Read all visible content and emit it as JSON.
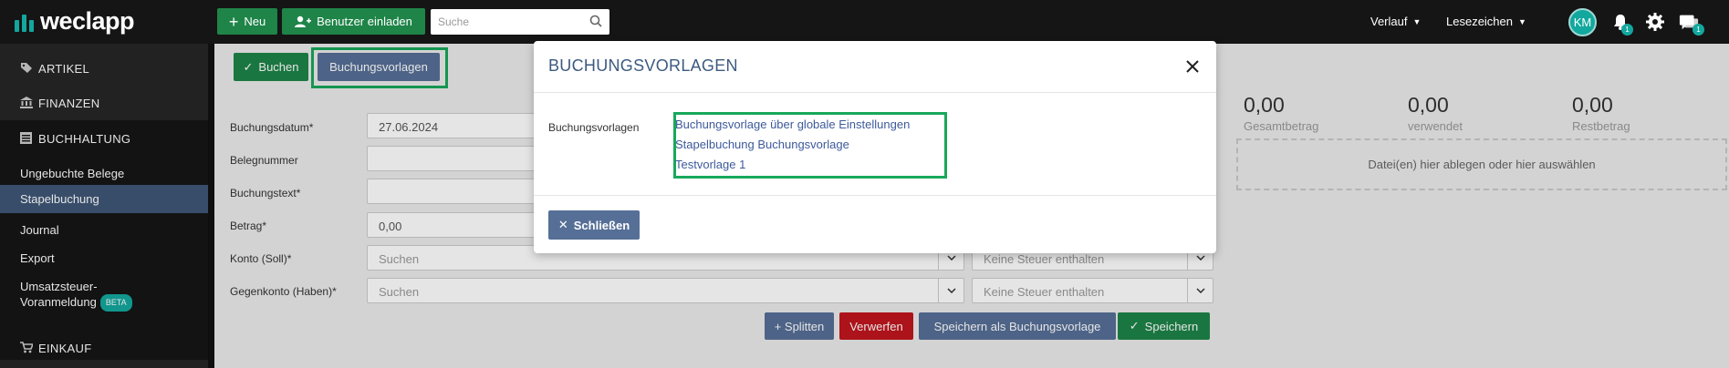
{
  "app": {
    "logo_text": "weclapp",
    "new_button": "Neu",
    "invite_button": "Benutzer einladen",
    "search_placeholder": "Suche",
    "history_label": "Verlauf",
    "bookmarks_label": "Lesezeichen",
    "avatar_initials": "KM",
    "notifications_count": "1",
    "messages_count": "1"
  },
  "sidebar": {
    "sections": [
      {
        "label": "ARTIKEL",
        "icon": "tags-icon"
      },
      {
        "label": "FINANZEN",
        "icon": "bank-icon"
      },
      {
        "label": "BUCHHALTUNG",
        "icon": "ledger-icon"
      }
    ],
    "items": [
      {
        "label": "Ungebuchte Belege"
      },
      {
        "label": "Stapelbuchung",
        "active": true
      },
      {
        "label": "Journal"
      },
      {
        "label": "Export"
      },
      {
        "label": "Umsatzsteuer-",
        "label2": "Voranmeldung",
        "badge": "BETA"
      }
    ],
    "bottom_section": {
      "label": "EINKAUF",
      "icon": "cart-icon"
    }
  },
  "toolbar": {
    "book_button": "Buchen",
    "templates_button": "Buchungsvorlagen"
  },
  "form": {
    "fields": [
      {
        "label": "Buchungsdatum*",
        "value": "27.06.2024"
      },
      {
        "label": "Belegnummer",
        "value": ""
      },
      {
        "label": "Buchungstext*",
        "value": ""
      },
      {
        "label": "Betrag*",
        "value": "0,00"
      },
      {
        "label": "Konto (Soll)*",
        "placeholder": "Suchen",
        "tax_placeholder": "Keine Steuer enthalten"
      },
      {
        "label": "Gegenkonto (Haben)*",
        "placeholder": "Suchen",
        "tax_placeholder": "Keine Steuer enthalten"
      }
    ],
    "actions": {
      "split": "+ Splitten",
      "discard": "Verwerfen",
      "save_template": "Speichern als Buchungsvorlage",
      "save": "Speichern"
    }
  },
  "summary": {
    "total": {
      "value": "0,00",
      "label": "Gesamtbetrag"
    },
    "used": {
      "value": "0,00",
      "label": "verwendet"
    },
    "rest": {
      "value": "0,00",
      "label": "Restbetrag"
    },
    "dropzone": "Datei(en) hier ablegen oder hier auswählen"
  },
  "modal": {
    "title": "BUCHUNGSVORLAGEN",
    "field_label": "Buchungsvorlagen",
    "templates": [
      "Buchungsvorlage über globale Einstellungen",
      "Stapelbuchung Buchungsvorlage",
      "Testvorlage 1"
    ],
    "close_button": "Schließen"
  },
  "colors": {
    "accent_green": "#1e8448",
    "brand_teal": "#13a89e",
    "button_blue": "#566f97",
    "danger_red": "#c1161d",
    "highlight_green": "#17a85a"
  }
}
